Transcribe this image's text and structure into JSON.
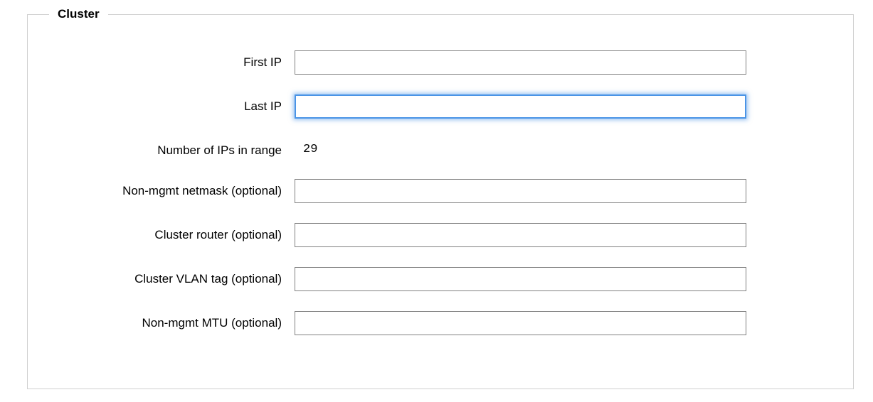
{
  "cluster": {
    "legend": "Cluster",
    "fields": {
      "first_ip": {
        "label": "First IP",
        "value": ""
      },
      "last_ip": {
        "label": "Last IP",
        "value": ""
      },
      "num_ips": {
        "label": "Number of IPs in range",
        "value": "29"
      },
      "non_mgmt_netmask": {
        "label": "Non-mgmt netmask (optional)",
        "value": ""
      },
      "cluster_router": {
        "label": "Cluster router (optional)",
        "value": ""
      },
      "cluster_vlan_tag": {
        "label": "Cluster VLAN tag (optional)",
        "value": ""
      },
      "non_mgmt_mtu": {
        "label": "Non-mgmt MTU (optional)",
        "value": ""
      }
    }
  }
}
